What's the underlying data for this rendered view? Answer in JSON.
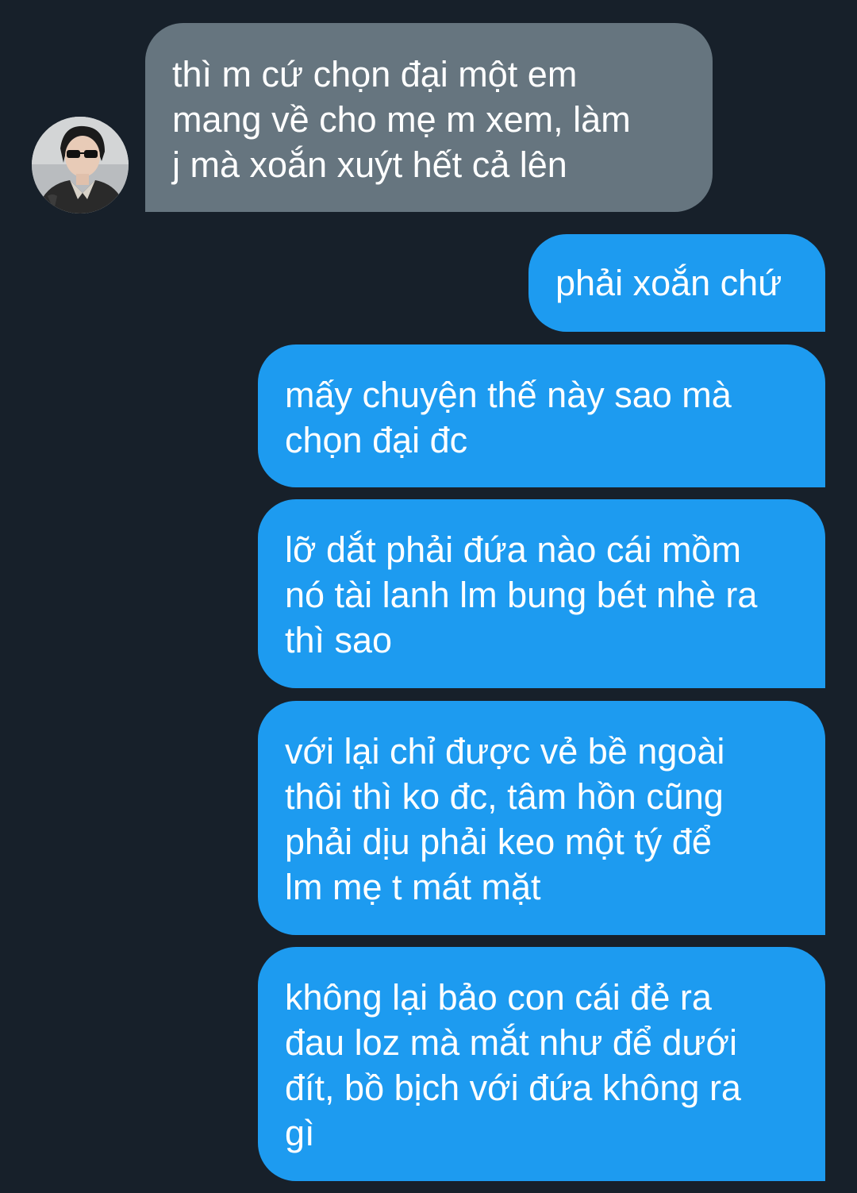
{
  "conversation": {
    "incoming": [
      {
        "text": "thì m cứ chọn đại một em\nmang về cho mẹ m xem, làm\nj mà xoắn xuýt hết cả lên"
      }
    ],
    "outgoing": [
      {
        "text": "phải xoắn chứ"
      },
      {
        "text": "mấy chuyện thế này sao mà\nchọn đại đc"
      },
      {
        "text": "lỡ dắt phải đứa nào cái mồm\nnó tài lanh lm bung bét nhè ra\nthì sao"
      },
      {
        "text": "với lại chỉ được vẻ bề ngoài\nthôi thì ko đc, tâm hồn cũng\nphải dịu phải keo một tý để\nlm mẹ t mát mặt"
      },
      {
        "text": "không lại bảo con cái đẻ ra\nđau loz mà mắt như để dưới\nđít, bồ bịch với đứa không ra\ngì"
      }
    ]
  },
  "colors": {
    "background": "#17202a",
    "incoming_bubble": "#66757f",
    "outgoing_bubble": "#1d9bf0",
    "text": "#ffffff"
  },
  "icons": {
    "avatar": "profile-photo"
  }
}
